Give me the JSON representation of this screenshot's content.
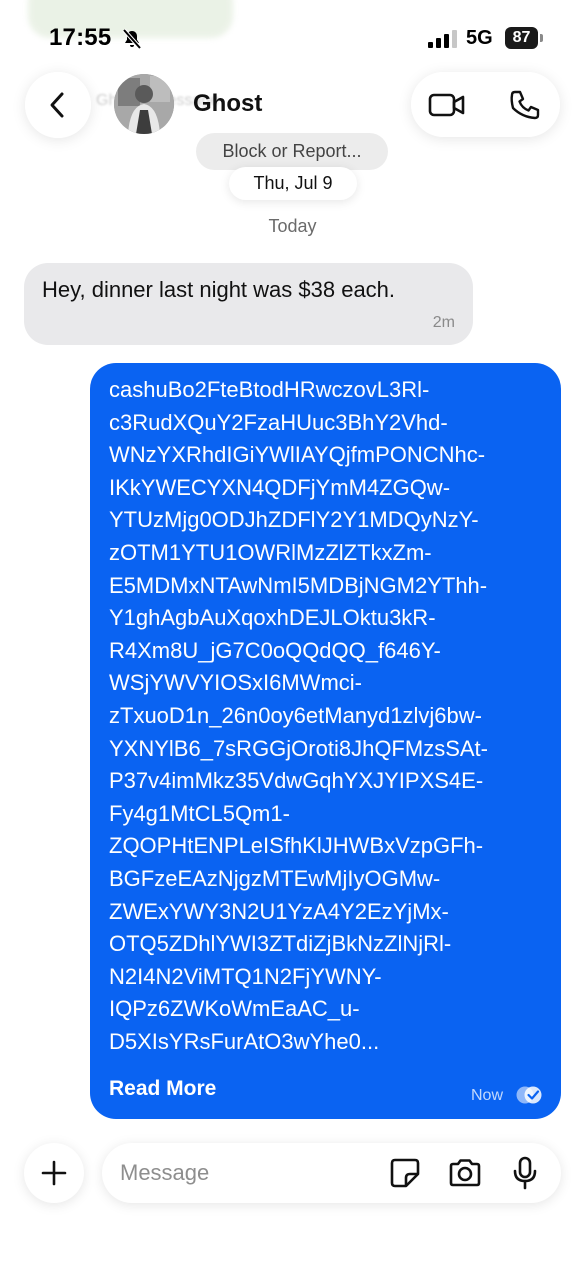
{
  "status_bar": {
    "time": "17:55",
    "network": "5G",
    "battery": "87"
  },
  "header": {
    "contact_name": "Ghost",
    "faded_preview": "Ghost's message",
    "block_report_label": "Block or Report...",
    "date_label": "Thu, Jul 9"
  },
  "thread": {
    "day_divider": "Today",
    "incoming": {
      "text": "Hey, dinner last night was $38 each.",
      "time": "2m"
    },
    "outgoing": {
      "lines": [
        "cashuBo2FteBtodHRwczovL3Rl-",
        "c3RudXQuY2FzaHUuc3BhY2Vhd-",
        "WNzYXRhdIGiYWlIAYQjfmPONCNhc-",
        "IKkYWECYXN4QDFjYmM4ZGQw-",
        "YTUzMjg0ODJhZDFlY2Y1MDQyNzY-",
        "zOTM1YTU1OWRlMzZlZTkxZm-",
        "E5MDMxNTAwNmI5MDBjNGM2YThh-",
        "Y1ghAgbAuXqoxhDEJLOktu3kR-",
        "R4Xm8U_jG7C0oQQdQQ_f646Y-",
        "WSjYWVYIOSxI6MWmci-",
        "zTxuoD1n_26n0oy6etManyd1zlvj6bw-",
        "YXNYlB6_7sRGGjOroti8JhQFMzsSAt-",
        "P37v4imMkz35VdwGqhYXJYIPXS4E-",
        "Fy4g1MtCL5Qm1-",
        "ZQOPHtENPLeISfhKlJHWBxVzpGFh-",
        "BGFzeEAzNjgzMTEwMjIyOGMw-",
        "ZWExYWY3N2U1YzA4Y2EzYjMx-",
        "OTQ5ZDhlYWI3ZTdiZjBkNzZlNjRl-",
        "N2I4N2ViMTQ1N2FjYWNY-",
        "IQPz6ZWKoWmEaAC_u-",
        "D5XIsYRsFurAtO3wYhe0..."
      ],
      "read_more": "Read More",
      "time": "Now"
    }
  },
  "composer": {
    "placeholder": "Message"
  },
  "colors": {
    "outgoing_bubble": "#0a63f2",
    "incoming_bubble": "#e9e9eb"
  },
  "icons": {
    "back": "chevron-left-icon",
    "video": "video-camera-icon",
    "phone": "phone-icon",
    "plus": "plus-icon",
    "sticker": "sticker-icon",
    "camera": "camera-icon",
    "mic": "microphone-icon",
    "seen": "double-check-icon",
    "silent": "bell-slash-icon"
  }
}
